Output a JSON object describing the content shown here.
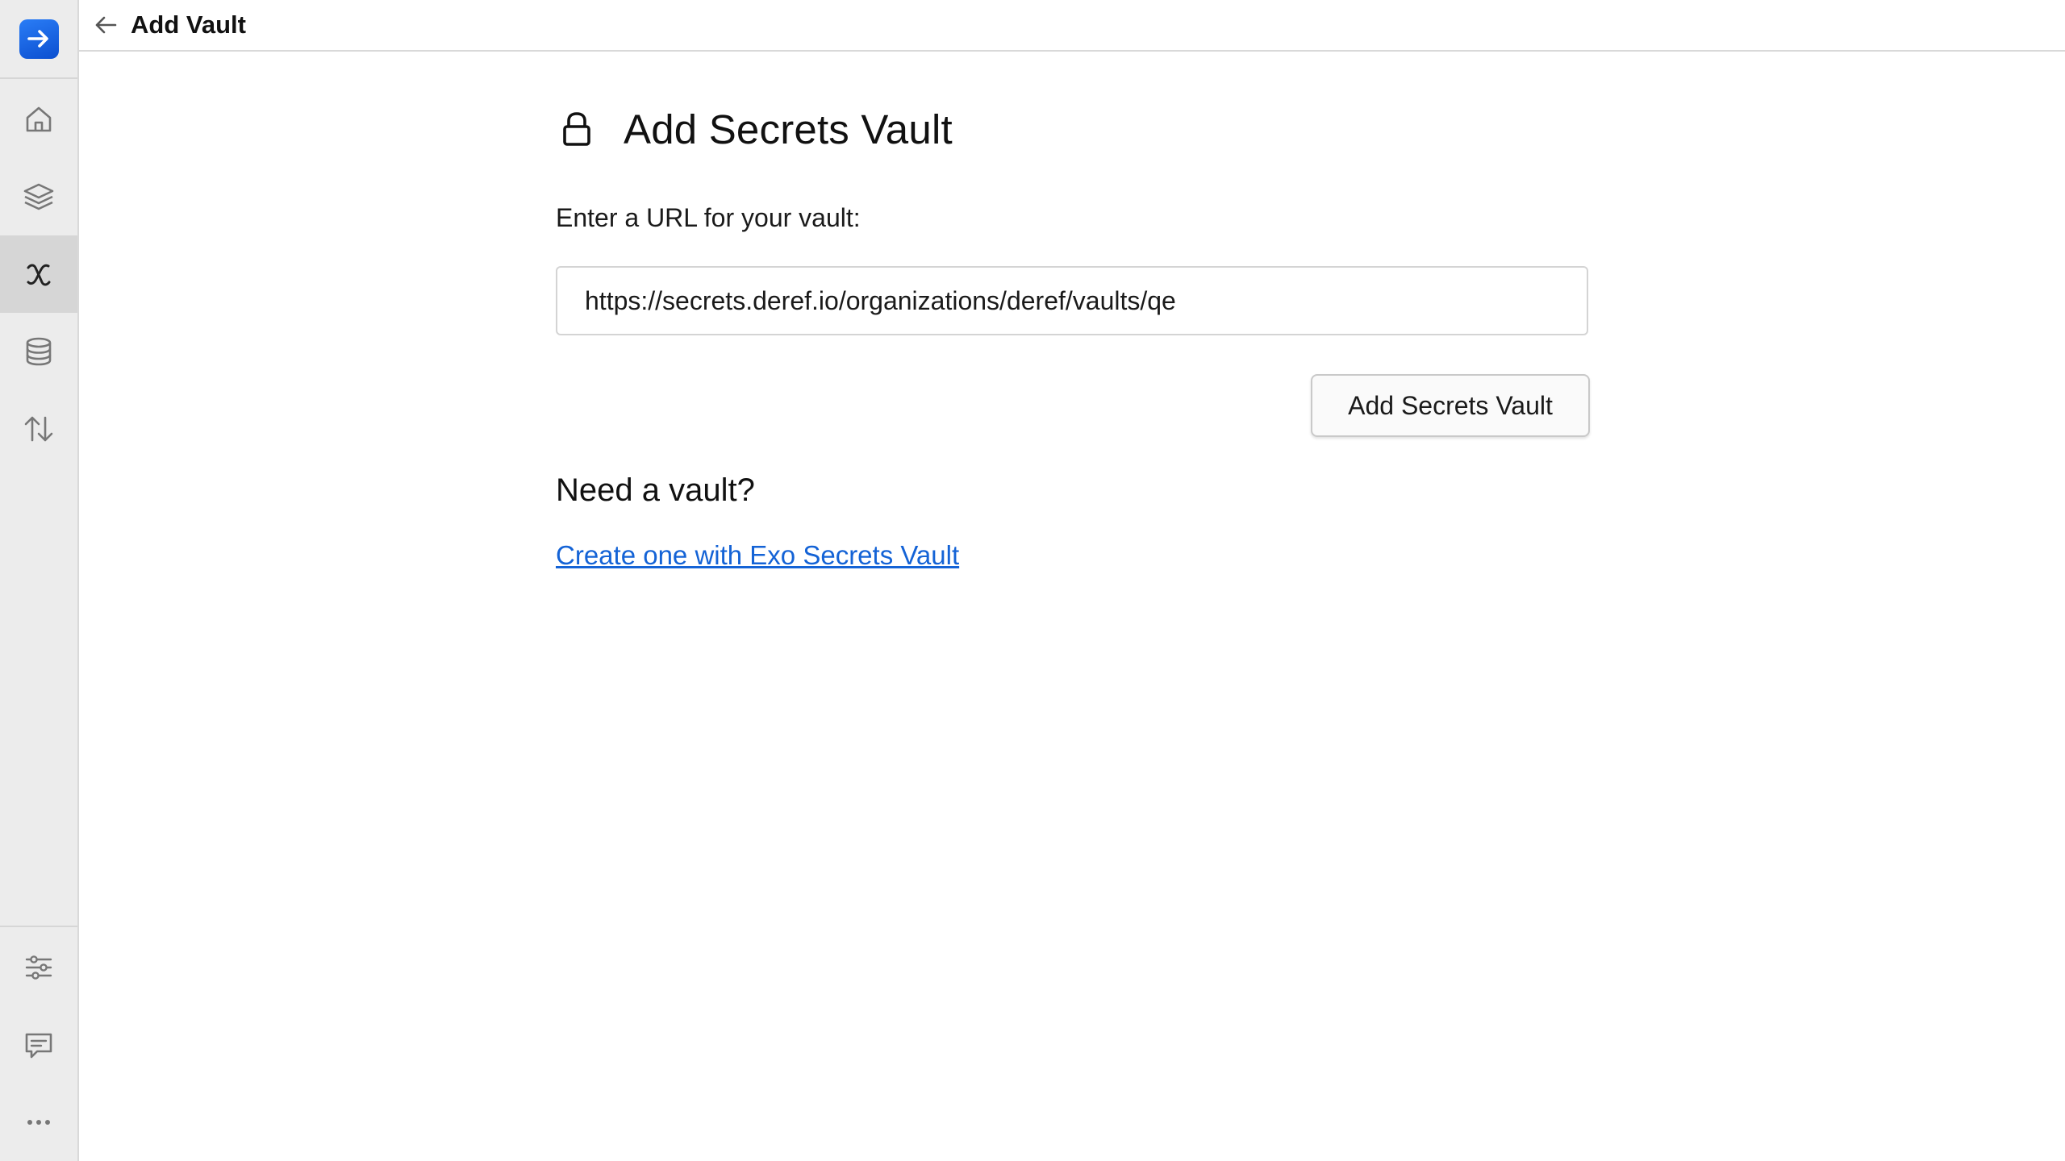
{
  "header": {
    "title": "Add Vault",
    "back_icon": "arrow-left-icon"
  },
  "sidebar": {
    "logo_icon": "app-logo-arrow-icon",
    "brand_color": "#1a66e8",
    "top_items": [
      {
        "icon": "home-icon",
        "active": false
      },
      {
        "icon": "layers-icon",
        "active": false
      },
      {
        "icon": "variable-x-icon",
        "active": true
      },
      {
        "icon": "database-icon",
        "active": false
      },
      {
        "icon": "sort-arrows-icon",
        "active": false
      }
    ],
    "bottom_items": [
      {
        "icon": "sliders-icon"
      },
      {
        "icon": "message-icon"
      },
      {
        "icon": "more-dots-icon"
      }
    ]
  },
  "main": {
    "title": "Add Secrets Vault",
    "title_icon": "lock-icon",
    "url_label": "Enter a URL for your vault:",
    "url_value": "https://secrets.deref.io/organizations/deref/vaults/qe",
    "submit_label": "Add Secrets Vault",
    "need_heading": "Need a vault?",
    "create_link": "Create one with Exo Secrets Vault",
    "link_color": "#1463d6"
  }
}
